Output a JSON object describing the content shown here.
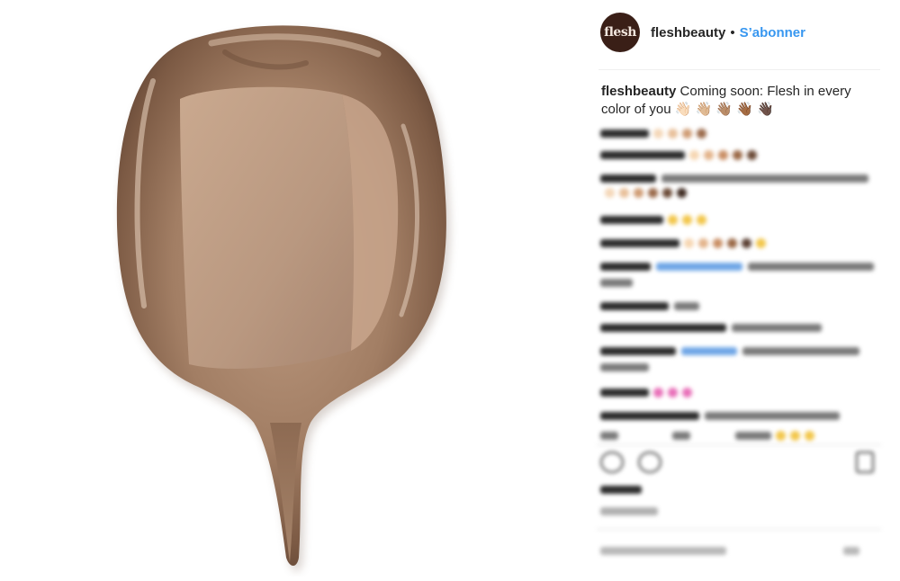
{
  "post": {
    "username": "fleshbeauty",
    "separator": "•",
    "follow_label": "S’abonner",
    "avatar_text": "flesh",
    "caption_user": "fleshbeauty",
    "caption_text": "Coming soon: Flesh in every color of you 👋🏻 👋🏼 👋🏽 👋🏾 👋🏿"
  },
  "colors": {
    "link": "#3897f0",
    "avatar_bg": "#3a1f17",
    "swatch_base": "#a9866c"
  },
  "icons": [
    "heart-icon",
    "comment-icon",
    "bookmark-icon"
  ]
}
